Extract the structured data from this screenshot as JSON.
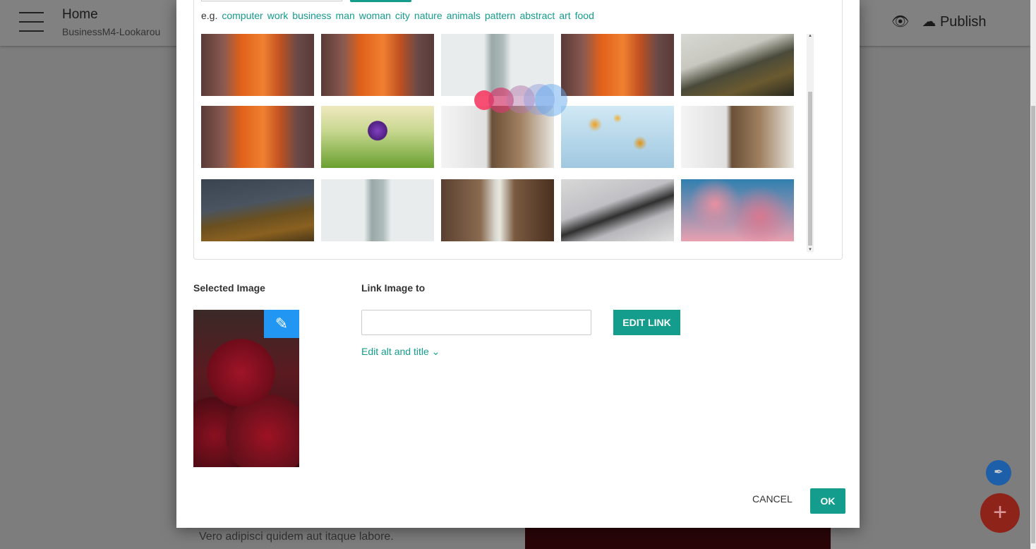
{
  "topbar": {
    "title": "Home",
    "project": "BusinessM4-Lookarou",
    "publish_label": "Publish"
  },
  "background": {
    "text": "Vero adipisci quidem aut itaque labore."
  },
  "modal": {
    "tags_prefix": "e.g.",
    "tags": [
      "computer",
      "work",
      "business",
      "man",
      "woman",
      "city",
      "nature",
      "animals",
      "pattern",
      "abstract",
      "art",
      "food"
    ],
    "thumbnails": [
      [
        "canyon",
        "canyon",
        "skyscraper-fog",
        "canyon",
        "misty-mountain"
      ],
      [
        "canyon",
        "phone-in-hand",
        "window-room",
        "yellow-flowers",
        "window-room"
      ],
      [
        "forest-mountain",
        "skyscraper-fog",
        "waterfall",
        "laptop-phone",
        "cherry-blossom"
      ]
    ],
    "selected_image_label": "Selected Image",
    "link_label": "Link Image to",
    "link_value": "",
    "edit_link_label": "EDIT LINK",
    "edit_alt_label": "Edit alt and title",
    "cancel_label": "CANCEL",
    "ok_label": "OK"
  },
  "colors": {
    "accent": "#149c8c",
    "pencil": "#2196f3"
  }
}
